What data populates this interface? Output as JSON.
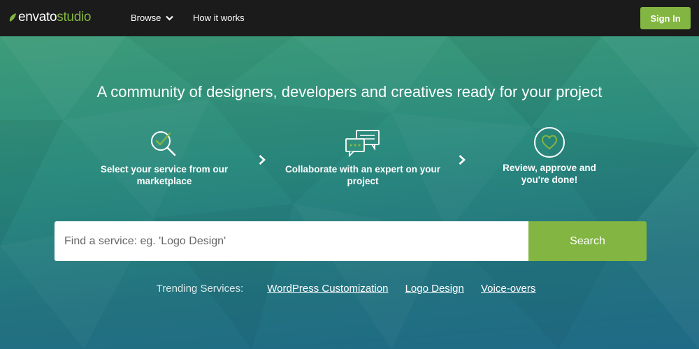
{
  "header": {
    "logo_part1": "envato",
    "logo_part2": "studio",
    "nav_browse": "Browse",
    "nav_how": "How it works",
    "signin_label": "Sign In"
  },
  "hero": {
    "headline": "A community of designers, developers and creatives ready for your project",
    "steps": [
      {
        "label": "Select your service from our marketplace",
        "icon": "magnifier-check-icon"
      },
      {
        "label": "Collaborate with an expert on your project",
        "icon": "chat-bubbles-icon"
      },
      {
        "label": "Review, approve and you're done!",
        "icon": "heart-circle-icon"
      }
    ]
  },
  "search": {
    "placeholder": "Find a service: eg. 'Logo Design'",
    "button_label": "Search"
  },
  "trending": {
    "label": "Trending Services:",
    "links": [
      "WordPress Customization",
      "Logo Design",
      "Voice-overs"
    ]
  },
  "colors": {
    "brand_green": "#82b541",
    "topbar": "#1b1b1b",
    "hero_top": "#3d9c78",
    "hero_bottom": "#1f6a86"
  }
}
